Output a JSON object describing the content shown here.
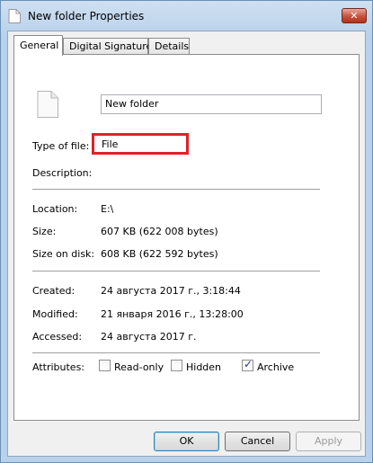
{
  "window": {
    "title": "New folder Properties",
    "close_label": "✕"
  },
  "tabs": [
    {
      "label": "General",
      "active": true
    },
    {
      "label": "Digital Signatures",
      "active": false
    },
    {
      "label": "Details",
      "active": false
    }
  ],
  "general": {
    "name_value": "New folder",
    "type_label": "Type of file:",
    "type_value": "File",
    "description_label": "Description:",
    "location_label": "Location:",
    "location_value": "E:\\",
    "size_label": "Size:",
    "size_value": "607 KB (622 008 bytes)",
    "size_on_disk_label": "Size on disk:",
    "size_on_disk_value": "608 KB (622 592 bytes)",
    "created_label": "Created:",
    "created_value": "24 августа 2017 г., 3:18:44",
    "modified_label": "Modified:",
    "modified_value": "21 января 2016 г., 13:28:00",
    "accessed_label": "Accessed:",
    "accessed_value": "24 августа 2017 г.",
    "attributes_label": "Attributes:",
    "attributes": [
      {
        "label": "Read-only",
        "checked": false
      },
      {
        "label": "Hidden",
        "checked": false
      },
      {
        "label": "Archive",
        "checked": true
      }
    ]
  },
  "buttons": {
    "ok": "OK",
    "cancel": "Cancel",
    "apply": "Apply"
  },
  "colors": {
    "highlight_border": "#e0202a",
    "title_gradient": "#b9d1ea"
  }
}
